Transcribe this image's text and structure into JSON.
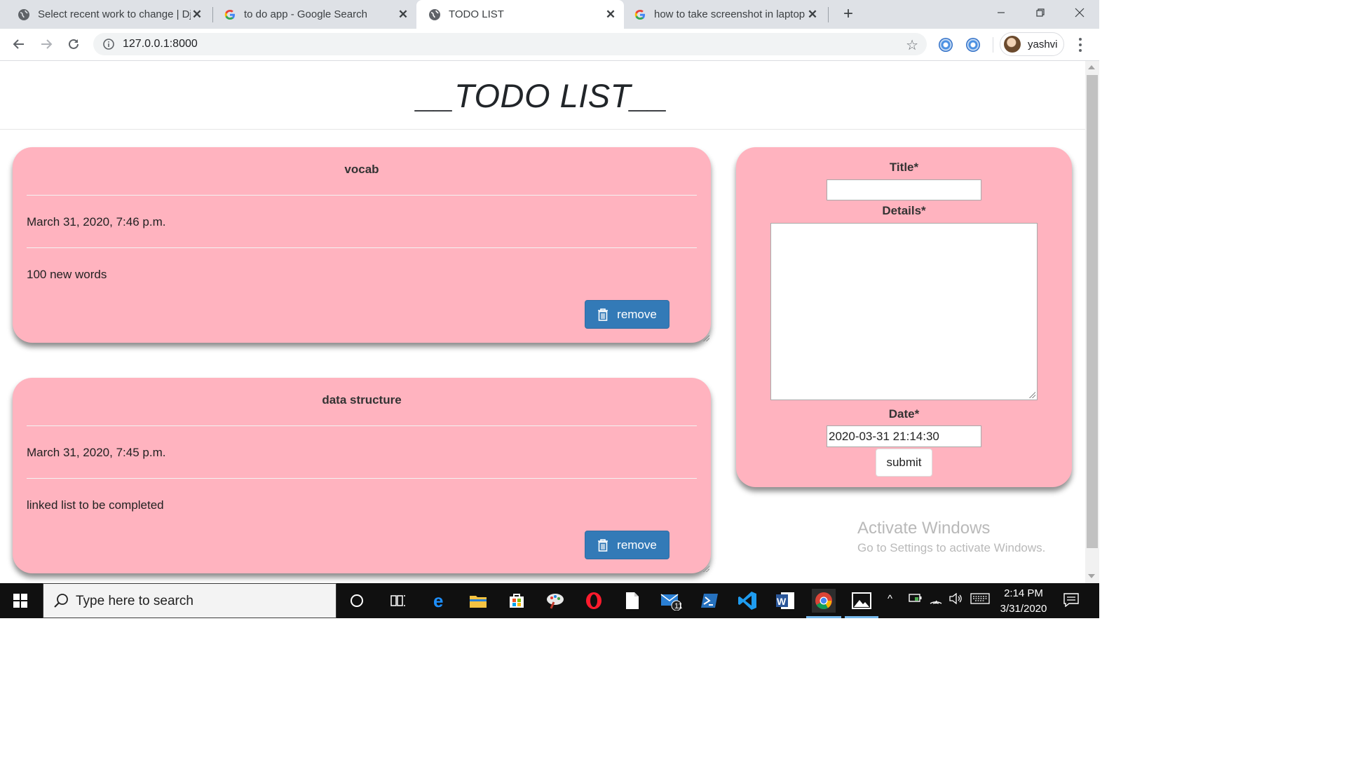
{
  "browser": {
    "tabs": [
      {
        "title": "Select recent work to change | Dj",
        "favicon": "globe-icon",
        "active": false
      },
      {
        "title": "to do app - Google Search",
        "favicon": "google-icon",
        "active": false
      },
      {
        "title": "TODO LIST",
        "favicon": "globe-icon",
        "active": true
      },
      {
        "title": "how to take screenshot in laptop",
        "favicon": "google-icon",
        "active": false
      }
    ],
    "url": "127.0.0.1:8000",
    "profile_name": "yashvi"
  },
  "page": {
    "title": "__TODO LIST__",
    "todos": [
      {
        "title": "vocab",
        "date": "March 31, 2020, 7:46 p.m.",
        "details": "100 new words",
        "remove_label": "remove"
      },
      {
        "title": "data structure",
        "date": "March 31, 2020, 7:45 p.m.",
        "details": "linked list to be completed",
        "remove_label": "remove"
      }
    ],
    "form": {
      "title_label": "Title*",
      "details_label": "Details*",
      "date_label": "Date*",
      "date_value": "2020-03-31 21:14:30",
      "submit_label": "submit"
    },
    "watermark": {
      "line1": "Activate Windows",
      "line2": "Go to Settings to activate Windows."
    }
  },
  "taskbar": {
    "search_placeholder": "Type here to search",
    "mail_badge": "11",
    "time": "2:14 PM",
    "date": "3/31/2020"
  },
  "colors": {
    "card_pink": "#ffb3bf",
    "remove_blue": "#337ab7"
  }
}
